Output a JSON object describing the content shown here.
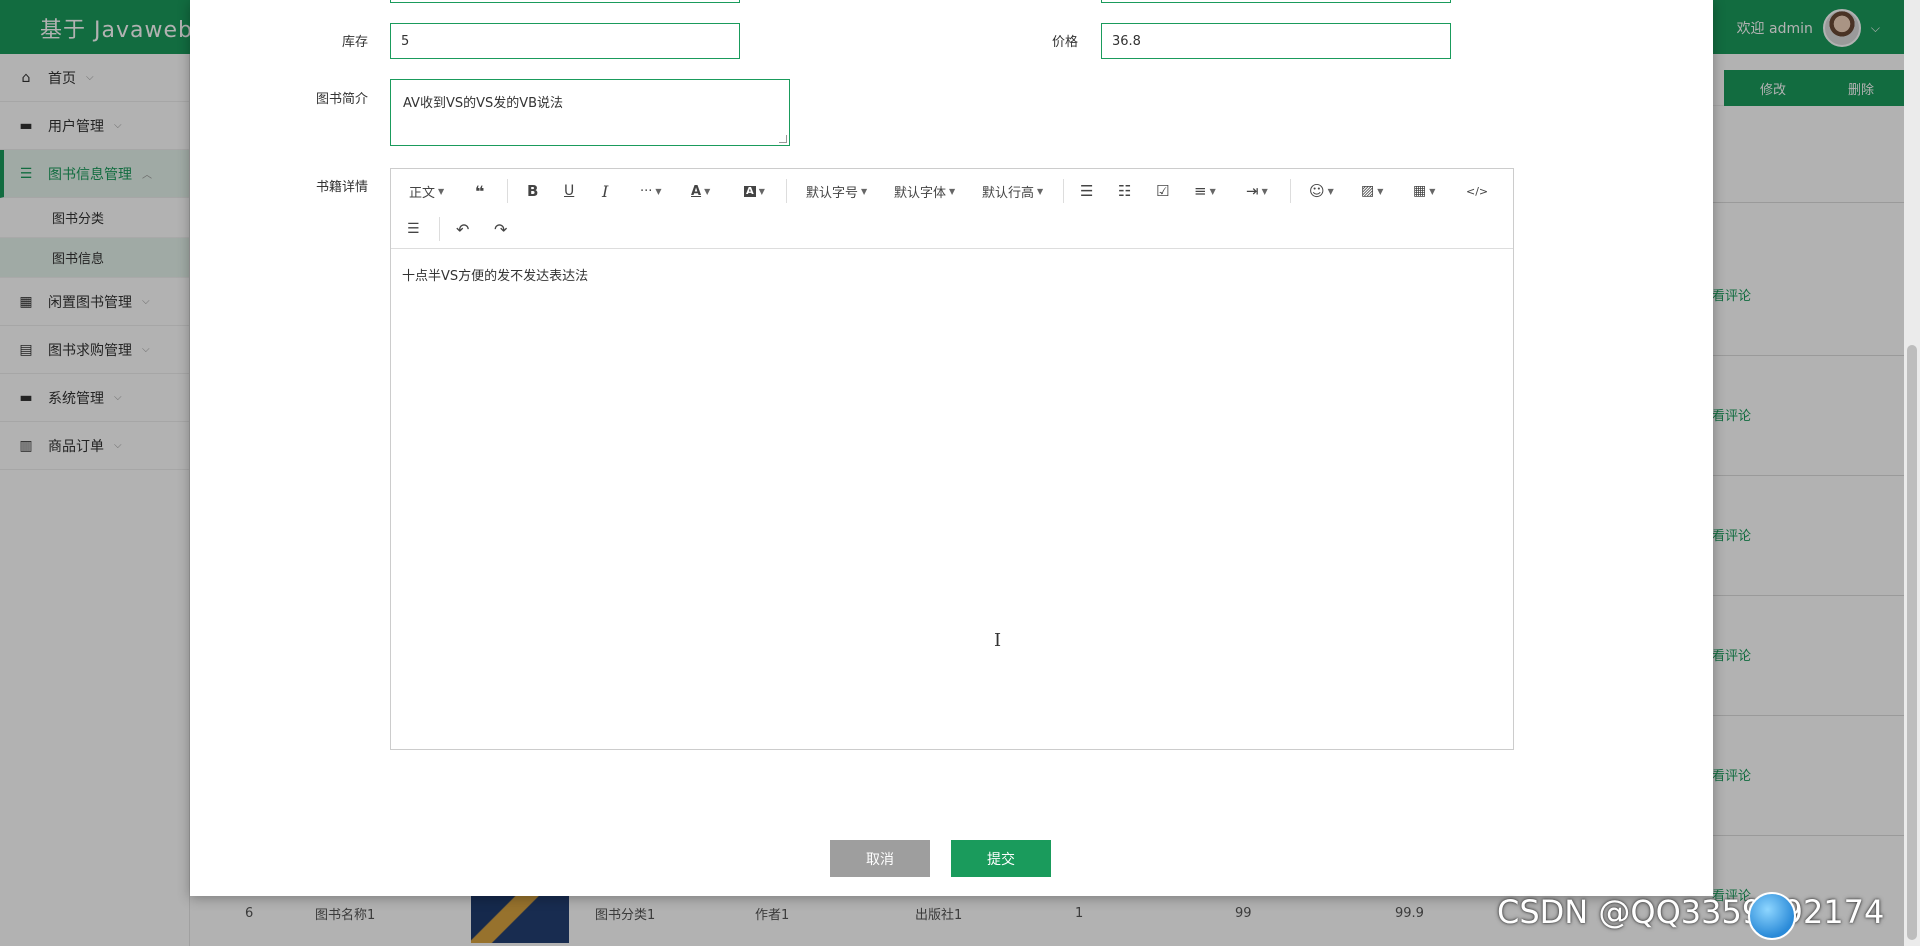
{
  "app": {
    "title": "基于 Javaweb 的",
    "welcome": "欢迎 admin"
  },
  "sidebar": {
    "items": [
      {
        "label": "首页",
        "icon": "home-icon"
      },
      {
        "label": "用户管理",
        "icon": "user-icon"
      },
      {
        "label": "图书信息管理",
        "icon": "list-icon",
        "active": true,
        "children": [
          {
            "label": "图书分类"
          },
          {
            "label": "图书信息",
            "active": true
          }
        ]
      },
      {
        "label": "闲置图书管理",
        "icon": "archive-icon"
      },
      {
        "label": "图书求购管理",
        "icon": "box-icon"
      },
      {
        "label": "系统管理",
        "icon": "settings-icon"
      },
      {
        "label": "商品订单",
        "icon": "order-icon"
      }
    ]
  },
  "background": {
    "edit_button": "修改",
    "delete_button": "删除",
    "row_link": "看评论",
    "bottom_row": [
      "6",
      "图书名称1",
      "图书分类1",
      "作者1",
      "出版社1",
      "1",
      "99",
      "99.9"
    ]
  },
  "form": {
    "stock_label": "库存",
    "stock_value": "5",
    "price_label": "价格",
    "price_value": "36.8",
    "intro_label": "图书简介",
    "intro_value": "AV收到VS的VS发的VB说法",
    "detail_label": "书籍详情",
    "detail_value": "十点半VS方便的发不发达表达法",
    "cancel_label": "取消",
    "submit_label": "提交"
  },
  "editor_toolbar": {
    "paragraph": "正文",
    "font_size": "默认字号",
    "font_family": "默认字体",
    "line_height": "默认行高"
  },
  "watermark": "CSDN @QQ3359892174",
  "colors": {
    "primary": "#1a9b5c",
    "cancel": "#9e9e9e"
  }
}
